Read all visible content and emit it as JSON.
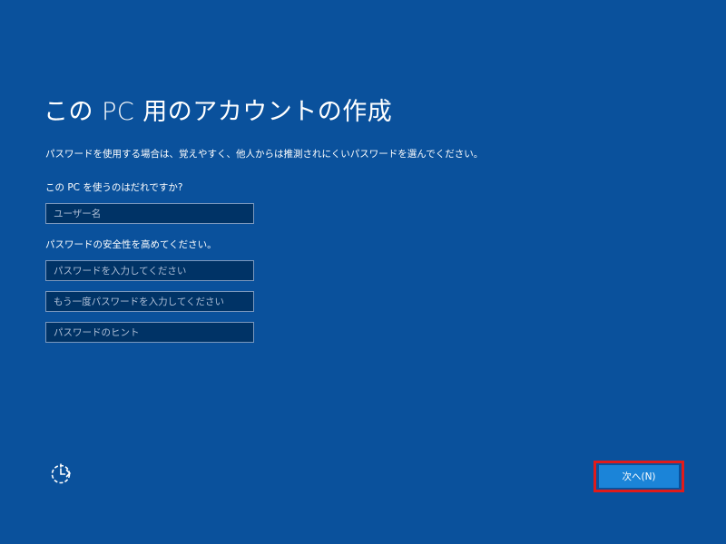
{
  "page": {
    "title": "この PC 用のアカウントの作成",
    "description": "パスワードを使用する場合は、覚えやすく、他人からは推測されにくいパスワードを選んでください。"
  },
  "user_section": {
    "label": "この PC を使うのはだれですか?",
    "username_placeholder": "ユーザー名"
  },
  "password_section": {
    "label": "パスワードの安全性を高めてください。",
    "password_placeholder": "パスワードを入力してください",
    "password_confirm_placeholder": "もう一度パスワードを入力してください",
    "password_hint_placeholder": "パスワードのヒント"
  },
  "footer": {
    "accessibility_icon": "ease-of-access-icon",
    "next_label": "次へ(N)",
    "highlight_color": "#e01b1b",
    "button_color": "#1b84d8"
  },
  "colors": {
    "background": "#0a519c",
    "field_background": "#003366",
    "text": "#ffffff"
  }
}
